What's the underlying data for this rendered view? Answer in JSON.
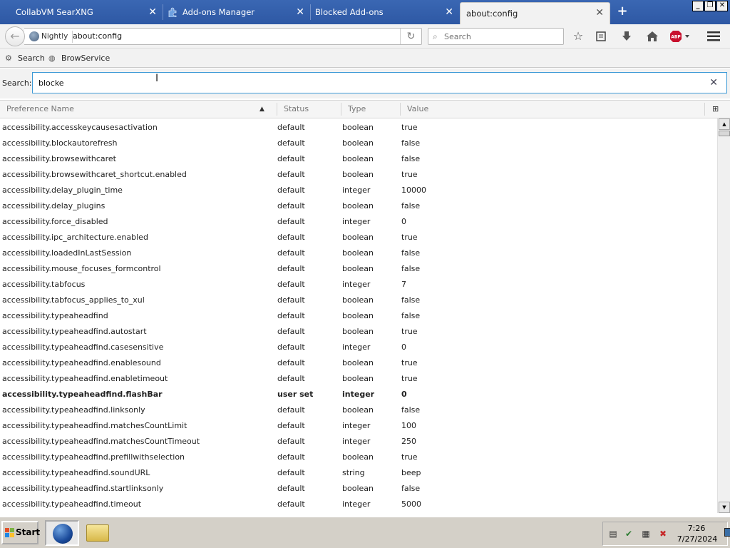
{
  "tabs": [
    {
      "title": "CollabVM SearXNG",
      "active": false
    },
    {
      "title": "Add-ons Manager",
      "active": false
    },
    {
      "title": "Blocked Add-ons",
      "active": false
    },
    {
      "title": "about:config",
      "active": true
    }
  ],
  "toolbar": {
    "identity_label": "Nightly",
    "url": "about:config",
    "search_placeholder": "Search"
  },
  "bookmarks": [
    {
      "label": "Search",
      "icon": "gear-icon"
    },
    {
      "label": "BrowService",
      "icon": "globe-icon"
    }
  ],
  "config": {
    "search_label": "Search:",
    "search_value": "blocke",
    "columns": {
      "name": "Preference Name",
      "status": "Status",
      "type": "Type",
      "value": "Value"
    },
    "rows": [
      {
        "name": "accessibility.accesskeycausesactivation",
        "status": "default",
        "type": "boolean",
        "value": "true"
      },
      {
        "name": "accessibility.blockautorefresh",
        "status": "default",
        "type": "boolean",
        "value": "false"
      },
      {
        "name": "accessibility.browsewithcaret",
        "status": "default",
        "type": "boolean",
        "value": "false"
      },
      {
        "name": "accessibility.browsewithcaret_shortcut.enabled",
        "status": "default",
        "type": "boolean",
        "value": "true"
      },
      {
        "name": "accessibility.delay_plugin_time",
        "status": "default",
        "type": "integer",
        "value": "10000"
      },
      {
        "name": "accessibility.delay_plugins",
        "status": "default",
        "type": "boolean",
        "value": "false"
      },
      {
        "name": "accessibility.force_disabled",
        "status": "default",
        "type": "integer",
        "value": "0"
      },
      {
        "name": "accessibility.ipc_architecture.enabled",
        "status": "default",
        "type": "boolean",
        "value": "true"
      },
      {
        "name": "accessibility.loadedInLastSession",
        "status": "default",
        "type": "boolean",
        "value": "false"
      },
      {
        "name": "accessibility.mouse_focuses_formcontrol",
        "status": "default",
        "type": "boolean",
        "value": "false"
      },
      {
        "name": "accessibility.tabfocus",
        "status": "default",
        "type": "integer",
        "value": "7"
      },
      {
        "name": "accessibility.tabfocus_applies_to_xul",
        "status": "default",
        "type": "boolean",
        "value": "false"
      },
      {
        "name": "accessibility.typeaheadfind",
        "status": "default",
        "type": "boolean",
        "value": "false"
      },
      {
        "name": "accessibility.typeaheadfind.autostart",
        "status": "default",
        "type": "boolean",
        "value": "true"
      },
      {
        "name": "accessibility.typeaheadfind.casesensitive",
        "status": "default",
        "type": "integer",
        "value": "0"
      },
      {
        "name": "accessibility.typeaheadfind.enablesound",
        "status": "default",
        "type": "boolean",
        "value": "true"
      },
      {
        "name": "accessibility.typeaheadfind.enabletimeout",
        "status": "default",
        "type": "boolean",
        "value": "true"
      },
      {
        "name": "accessibility.typeaheadfind.flashBar",
        "status": "user set",
        "type": "integer",
        "value": "0"
      },
      {
        "name": "accessibility.typeaheadfind.linksonly",
        "status": "default",
        "type": "boolean",
        "value": "false"
      },
      {
        "name": "accessibility.typeaheadfind.matchesCountLimit",
        "status": "default",
        "type": "integer",
        "value": "100"
      },
      {
        "name": "accessibility.typeaheadfind.matchesCountTimeout",
        "status": "default",
        "type": "integer",
        "value": "250"
      },
      {
        "name": "accessibility.typeaheadfind.prefillwithselection",
        "status": "default",
        "type": "boolean",
        "value": "true"
      },
      {
        "name": "accessibility.typeaheadfind.soundURL",
        "status": "default",
        "type": "string",
        "value": "beep"
      },
      {
        "name": "accessibility.typeaheadfind.startlinksonly",
        "status": "default",
        "type": "boolean",
        "value": "false"
      },
      {
        "name": "accessibility.typeaheadfind.timeout",
        "status": "default",
        "type": "integer",
        "value": "5000"
      }
    ]
  },
  "taskbar": {
    "start_label": "Start",
    "time": "7:26",
    "date": "7/27/2024"
  },
  "colors": {
    "tabstrip": "#2e58a4",
    "search_focus": "#3d9ad6",
    "taskbar": "#d4d0c8"
  }
}
